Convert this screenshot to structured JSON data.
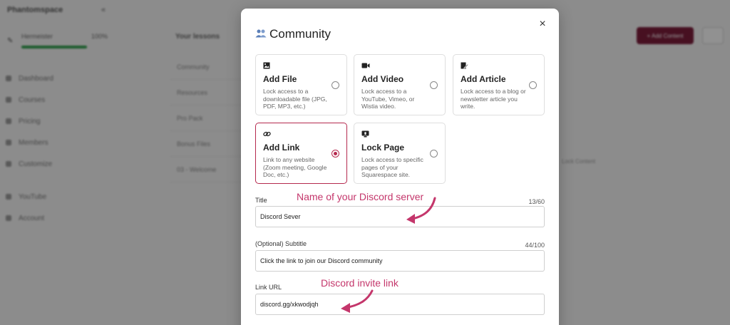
{
  "background": {
    "brand": "Phantomspace",
    "collapse_icon": "«",
    "progress_label": "Hermeister",
    "progress_pct": "100%",
    "progress_value": 1.0,
    "nav": [
      "Dashboard",
      "Courses",
      "Pricing",
      "Members",
      "Customize",
      "YouTube",
      "Account"
    ],
    "section_title": "Your lessons",
    "rows": [
      "Community",
      "Resources",
      "Pro Pack",
      "Bonus Files",
      "03 - Welcome"
    ],
    "cta_label": "+ Add Content",
    "side_text": "Lock Content"
  },
  "modal": {
    "title": "Community",
    "title_icon": "people-icon",
    "close_icon": "×",
    "cards": [
      {
        "id": "add-file",
        "icon": "image-icon",
        "glyph": "▣",
        "title": "Add File",
        "desc": "Lock access to a downloadable file (JPG, PDF, MP3, etc.)",
        "selected": false
      },
      {
        "id": "add-video",
        "icon": "video-icon",
        "glyph": "■",
        "title": "Add Video",
        "desc": "Lock access to a YouTube, Vimeo, or Wistia video.",
        "selected": false
      },
      {
        "id": "add-article",
        "icon": "edit-note-icon",
        "glyph": "✎",
        "title": "Add Article",
        "desc": "Lock access to a blog or newsletter article you write.",
        "selected": false
      },
      {
        "id": "add-link",
        "icon": "link-icon",
        "glyph": "⊘",
        "title": "Add Link",
        "desc": "Link to any website (Zoom meeting, Google Doc, etc.)",
        "selected": true
      },
      {
        "id": "lock-page",
        "icon": "page-lock-icon",
        "glyph": "▤",
        "title": "Lock Page",
        "desc": "Lock access to specific pages of your Squarespace site.",
        "selected": false
      }
    ],
    "fields": {
      "title": {
        "label": "Title",
        "count": "13/60",
        "value": "Discord Sever"
      },
      "subtitle": {
        "label": "(Optional) Subtitle",
        "count": "44/100",
        "value": "Click the link to join our Discord community"
      },
      "link_url": {
        "label": "Link URL",
        "value": "discord.gg/xkwodjqh"
      }
    }
  },
  "annotations": {
    "title_note": "Name of your Discord server",
    "link_note": "Discord invite link",
    "color": "#c4366b"
  },
  "colors": {
    "accent": "#b5294e",
    "overlay": "rgba(0,0,0,0.42)"
  }
}
